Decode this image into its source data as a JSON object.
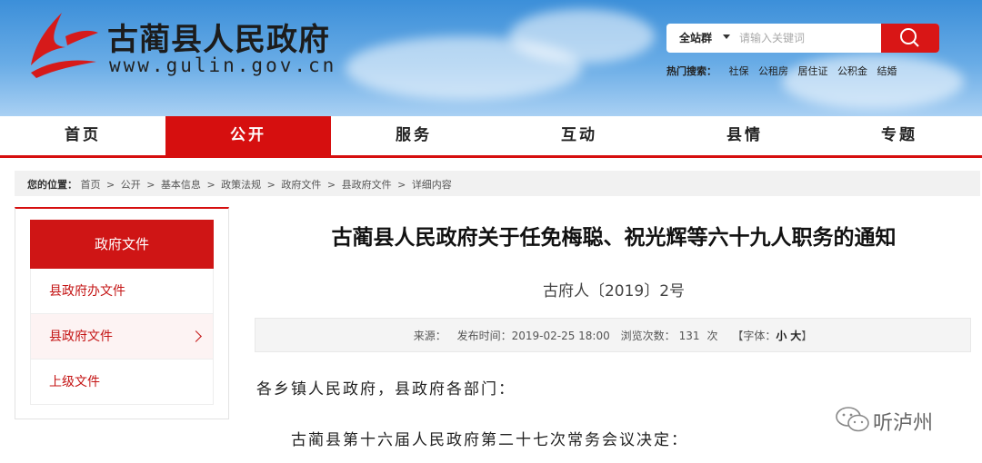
{
  "header": {
    "site_title": "古蔺县人民政府",
    "site_url": "www.gulin.gov.cn",
    "search": {
      "scope": "全站群",
      "placeholder": "请输入关键词"
    },
    "hot_search": {
      "label": "热门搜索：",
      "items": [
        "社保",
        "公租房",
        "居住证",
        "公积金",
        "结婚"
      ]
    }
  },
  "nav": {
    "items": [
      "首页",
      "公开",
      "服务",
      "互动",
      "县情",
      "专题"
    ],
    "active": "公开"
  },
  "breadcrumb": {
    "label": "您的位置：",
    "items": [
      "首页",
      "公开",
      "基本信息",
      "政策法规",
      "政府文件",
      "县政府文件",
      "详细内容"
    ],
    "separator": ">"
  },
  "sidebar": {
    "heading": "政府文件",
    "items": [
      "县政府办文件",
      "县政府文件",
      "上级文件"
    ],
    "active": "县政府文件"
  },
  "article": {
    "title": "古蔺县人民政府关于任免梅聪、祝光辉等六十九人职务的通知",
    "doc_number": "古府人〔2019〕2号",
    "meta": {
      "source": "来源：",
      "publish_time": "发布时间：2019-02-25 18:00",
      "views_label": "浏览次数：",
      "views_count": "131",
      "views_unit": "次",
      "font_prefix": "【字体：",
      "font_small": "小",
      "font_large": "大",
      "font_suffix": "】"
    },
    "greeting": "各乡镇人民政府，县政府各部门：",
    "first_line": "古蔺县第十六届人民政府第二十七次常务会议决定："
  },
  "watermark": "听泸州",
  "colors": {
    "brand_red": "#d60f0f",
    "header_blue": "#3c8fd9"
  }
}
